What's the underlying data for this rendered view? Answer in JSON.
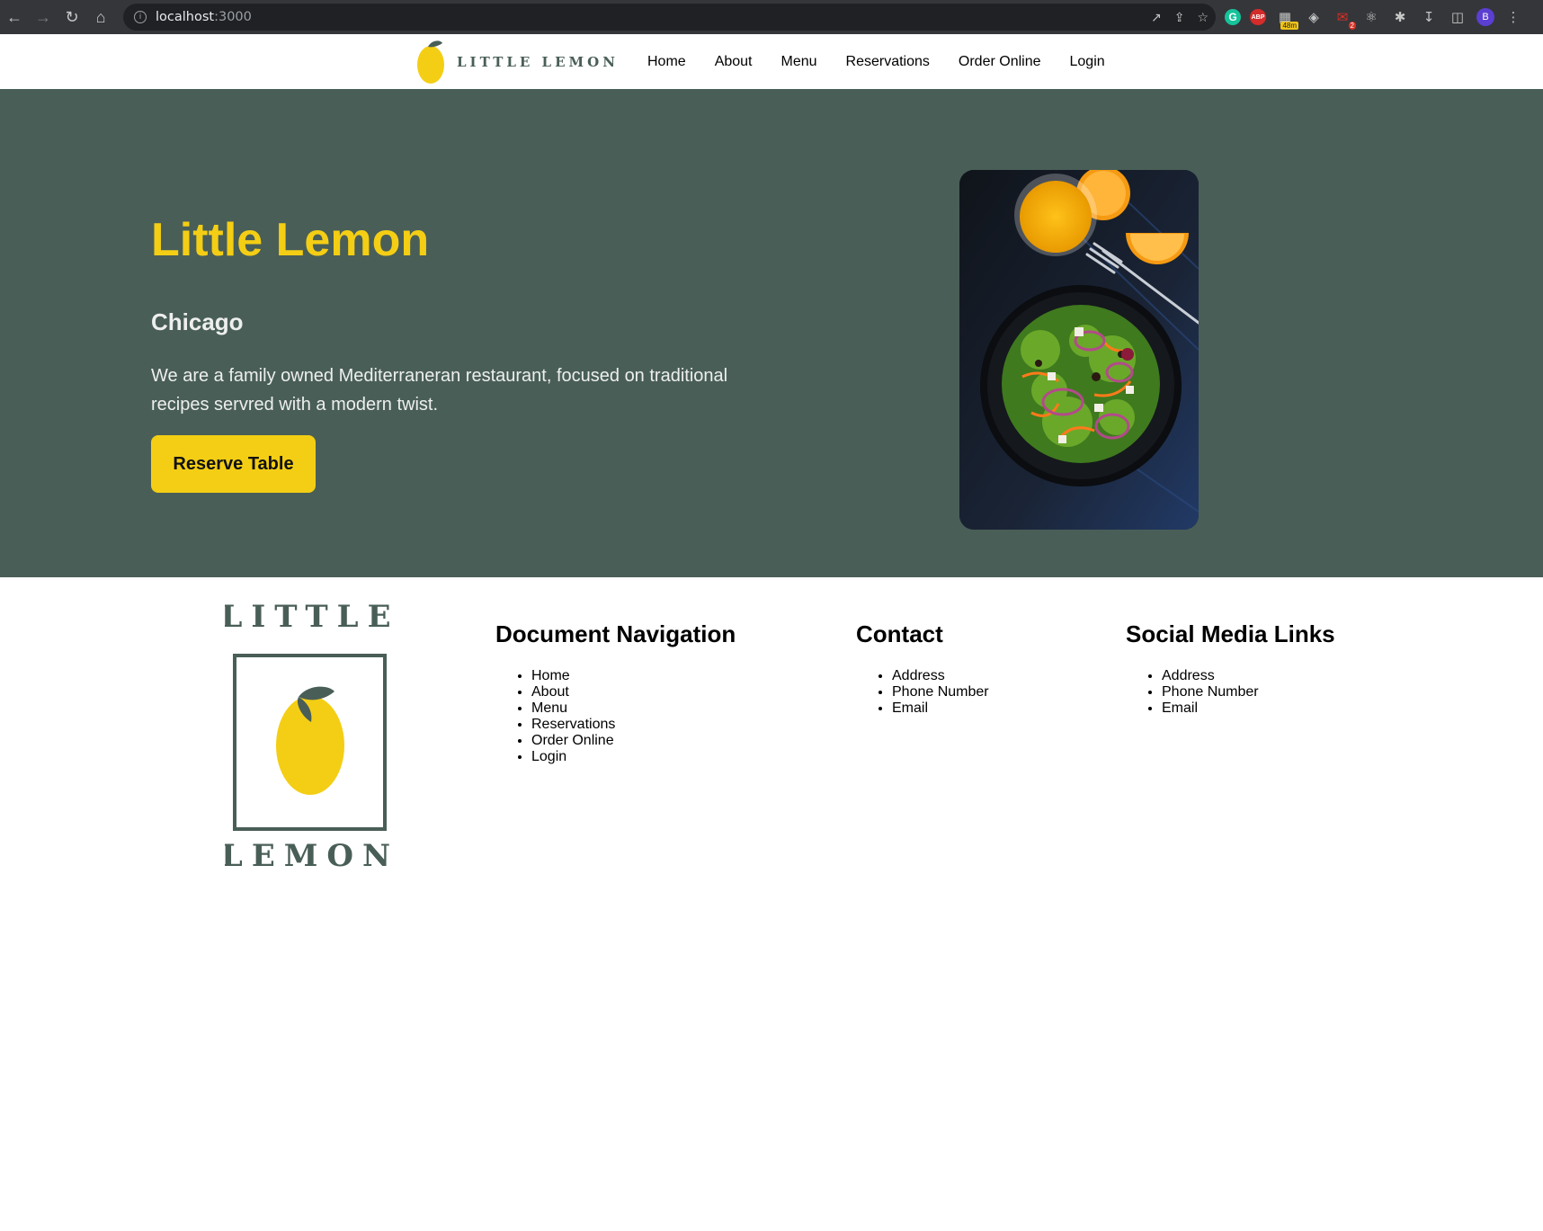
{
  "browser": {
    "url_host": "localhost",
    "url_port": ":3000",
    "extensions": {
      "grammarly": "G",
      "abp": "ABP",
      "timer_badge": "48m",
      "mail_badge": "2",
      "profile": "B"
    }
  },
  "header": {
    "logo_text": "LITTLE LEMON",
    "nav": [
      "Home",
      "About",
      "Menu",
      "Reservations",
      "Order Online",
      "Login"
    ]
  },
  "hero": {
    "title": "Little Lemon",
    "subtitle": "Chicago",
    "description": "We are a family owned Mediterraneran restaurant, focused on traditional recipes servred with a modern twist.",
    "button_label": "Reserve Table"
  },
  "footer": {
    "logo_top": "LITTLE",
    "logo_bottom": "LEMON",
    "navigation": {
      "heading": "Document Navigation",
      "items": [
        "Home",
        "About",
        "Menu",
        "Reservations",
        "Order Online",
        "Login"
      ]
    },
    "contact": {
      "heading": "Contact",
      "items": [
        "Address",
        "Phone Number",
        "Email"
      ]
    },
    "social": {
      "heading": "Social Media Links",
      "items": [
        "Address",
        "Phone Number",
        "Email"
      ]
    }
  },
  "colors": {
    "primary_green": "#495e57",
    "primary_yellow": "#f4ce14",
    "light_text": "#edefee"
  }
}
